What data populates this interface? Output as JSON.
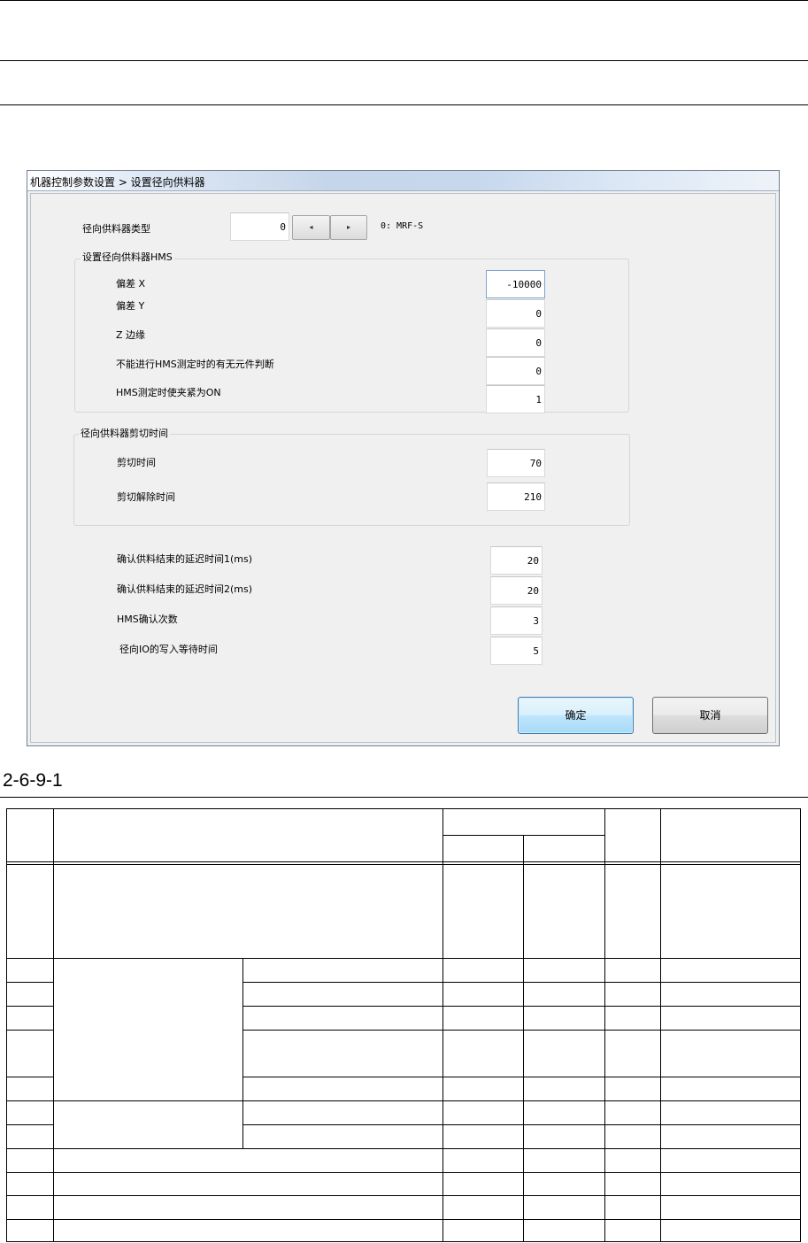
{
  "window": {
    "title": "机器控制参数设置 > 设置径向供料器",
    "feeder_type": {
      "label": "径向供料器类型",
      "value": "0",
      "left_arrow": "◂",
      "right_arrow": "▸",
      "hint": "0: MRF-S"
    },
    "hms_group": {
      "title": "设置径向供料器HMS",
      "fields": [
        {
          "label": "偏差 X",
          "value": "-10000"
        },
        {
          "label": "偏差 Y",
          "value": "0"
        },
        {
          "label": "Z 边缘",
          "value": "0"
        },
        {
          "label": "不能进行HMS测定时的有无元件判断",
          "value": "0"
        },
        {
          "label": "HMS测定时使夹紧为ON",
          "value": "1"
        }
      ]
    },
    "cut_group": {
      "title": "径向供料器剪切时间",
      "fields": [
        {
          "label": "剪切时间",
          "value": "70"
        },
        {
          "label": "剪切解除时间",
          "value": "210"
        }
      ]
    },
    "misc_fields": [
      {
        "label": "确认供料结束的延迟时间1(ms)",
        "value": "20"
      },
      {
        "label": "确认供料结束的延迟时间2(ms)",
        "value": "20"
      },
      {
        "label": "HMS确认次数",
        "value": "3"
      },
      {
        "label": "径向IO的写入等待时间",
        "value": "5"
      }
    ],
    "buttons": {
      "ok": "确定",
      "cancel": "取消"
    }
  },
  "caption": "2-6-9-1"
}
